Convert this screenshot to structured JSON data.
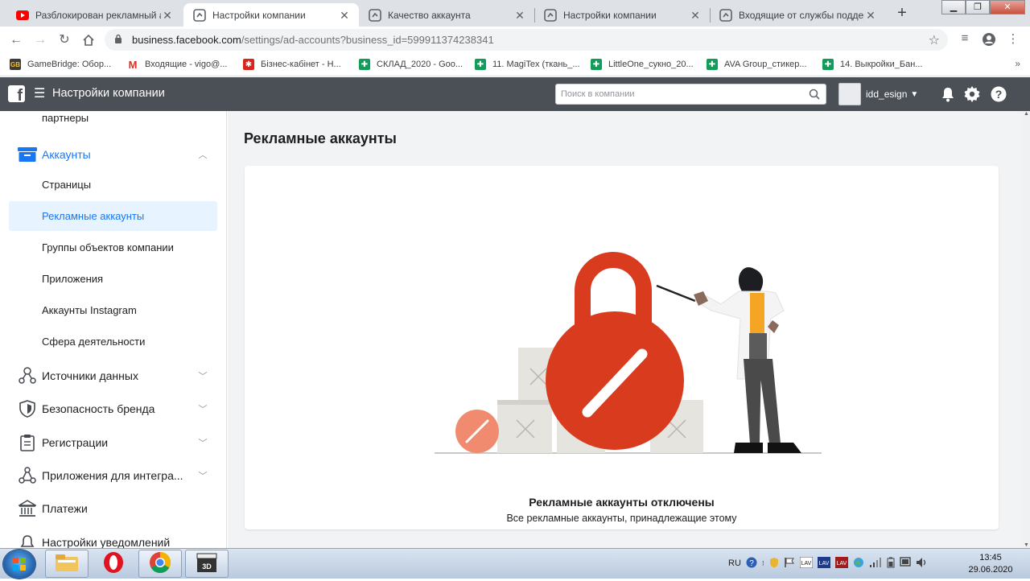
{
  "browser": {
    "tabs": [
      {
        "title": "Разблокирован рекламный акк",
        "favicon": "youtube-icon",
        "active": false
      },
      {
        "title": "Настройки компании",
        "favicon": "fb-business-icon",
        "active": true
      },
      {
        "title": "Качество аккаунта",
        "favicon": "fb-business-icon",
        "active": false
      },
      {
        "title": "Настройки компании",
        "favicon": "fb-business-icon",
        "active": false
      },
      {
        "title": "Входящие от службы поддерж",
        "favicon": "fb-business-icon",
        "active": false
      }
    ],
    "url_host": "business.facebook.com",
    "url_path": "/settings/ad-accounts?business_id=599911374238341",
    "bookmarks": [
      {
        "label": "GameBridge: Обор...",
        "icon": "gamebridge-icon",
        "color": "#3b3b3b"
      },
      {
        "label": "Входящие - vigo@...",
        "icon": "gmail-icon",
        "color": "#ffffff"
      },
      {
        "label": "Бізнес-кабінет - Н...",
        "icon": "privat-icon",
        "color": "#d9261c"
      },
      {
        "label": "СКЛАД_2020 - Goo...",
        "icon": "sheets-icon",
        "color": "#0f9d58"
      },
      {
        "label": "11. MagiTex (ткань_...",
        "icon": "sheets-icon",
        "color": "#0f9d58"
      },
      {
        "label": "LittleOne_сукно_20...",
        "icon": "sheets-icon",
        "color": "#0f9d58"
      },
      {
        "label": "AVA Group_стикер...",
        "icon": "sheets-icon",
        "color": "#0f9d58"
      },
      {
        "label": "14. Выкройки_Бан...",
        "icon": "sheets-icon",
        "color": "#0f9d58"
      }
    ]
  },
  "header": {
    "title": "Настройки компании",
    "search_placeholder": "Поиск в компании",
    "user_name": "idd_esign"
  },
  "sidebar": {
    "partial_item": "партнеры",
    "accounts_label": "Аккаунты",
    "sub_items": [
      {
        "label": "Страницы",
        "active": false
      },
      {
        "label": "Рекламные аккаунты",
        "active": true
      },
      {
        "label": "Группы объектов компании",
        "active": false
      },
      {
        "label": "Приложения",
        "active": false
      },
      {
        "label": "Аккаунты Instagram",
        "active": false
      },
      {
        "label": "Сфера деятельности",
        "active": false
      }
    ],
    "sections": [
      {
        "label": "Источники данных",
        "icon": "data-sources-icon"
      },
      {
        "label": "Безопасность бренда",
        "icon": "shield-icon"
      },
      {
        "label": "Регистрации",
        "icon": "clipboard-icon"
      },
      {
        "label": "Приложения для интегра...",
        "icon": "integrations-icon"
      },
      {
        "label": "Платежи",
        "icon": "bank-icon"
      }
    ],
    "partial_bottom": "Настройки уведомлений"
  },
  "main": {
    "title": "Рекламные аккаунты",
    "empty_heading": "Рекламные аккаунты отключены",
    "empty_text": "Все рекламные аккаунты, принадлежащие этому"
  },
  "taskbar": {
    "lang": "RU",
    "time": "13:45",
    "date": "29.06.2020"
  },
  "colors": {
    "fb_header": "#4b4f56",
    "accent_blue": "#1877f2",
    "lock_red": "#d93b1f"
  }
}
